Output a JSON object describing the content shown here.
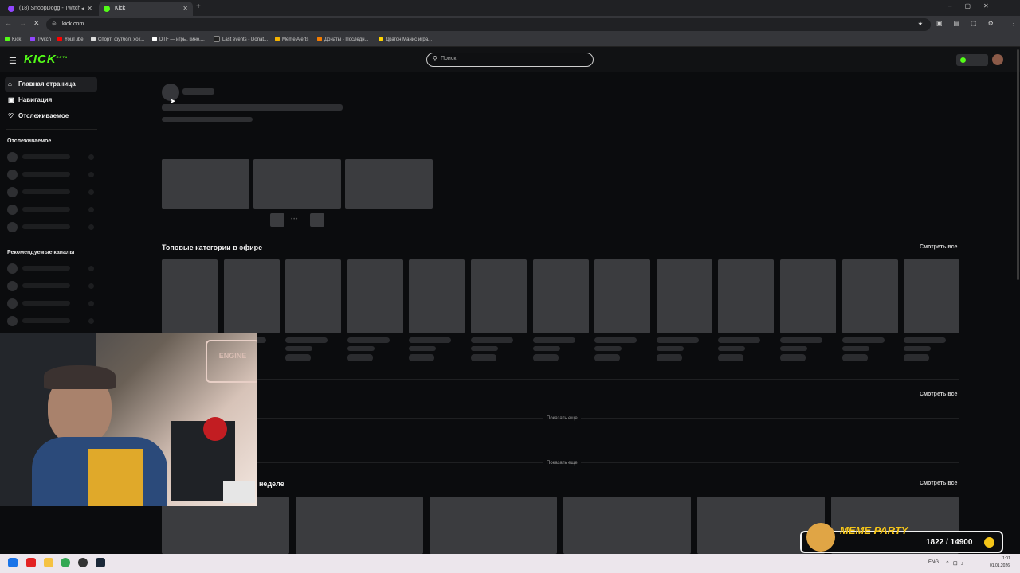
{
  "browser": {
    "tabs": [
      {
        "title": "(18) SnoopDogg - Twitch",
        "active": false
      },
      {
        "title": "Kick",
        "active": true
      }
    ],
    "url": "kick.com",
    "bookmarks": [
      "Kick",
      "Twitch",
      "YouTube",
      "Спорт: футбол, хок...",
      "DTF — игры, кино,...",
      "Last events - Donat...",
      "Meme Alerts",
      "Донаты - Последн...",
      "Драгон Манис игра..."
    ]
  },
  "site": {
    "logo": "KICK",
    "logo_badge": "BETA",
    "search_placeholder": "Поиск"
  },
  "sidebar": {
    "nav": [
      {
        "label": "Главная страница",
        "icon": "home-icon"
      },
      {
        "label": "Навигация",
        "icon": "compass-icon"
      },
      {
        "label": "Отслеживаемое",
        "icon": "heart-icon"
      }
    ],
    "following_title": "Отслеживаемое",
    "recommended_title": "Рекомендуемые каналы"
  },
  "main": {
    "top_categories_title": "Топовые категории в эфире",
    "view_all": "Смотреть все",
    "show_more": "Показать еще",
    "week_title_partial": "неделе"
  },
  "overlay": {
    "meme_title": "MEME PARTY",
    "meme_progress": "1822 / 14900",
    "meme_current": 1822,
    "meme_goal": 14900
  },
  "taskbar": {
    "lang": "ENG",
    "time": "1:01",
    "date": "01.01.2026"
  },
  "colors": {
    "kick_green": "#53fc18",
    "bg": "#0b0c0e",
    "skeleton": "#3b3c3f",
    "meme_yellow": "#f5c518"
  }
}
